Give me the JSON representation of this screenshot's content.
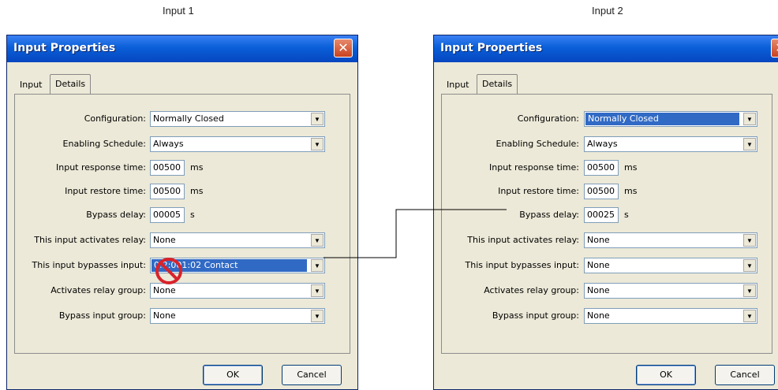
{
  "captions": [
    "Input 1",
    "Input 2"
  ],
  "dialogs": [
    {
      "title": "Input Properties",
      "close_glyph": "✕",
      "tabs": [
        "Input",
        "Details"
      ],
      "active_tab": "Details",
      "configuration": "Normally Closed",
      "enabling_schedule": "Always",
      "input_response_time": "00500",
      "input_restore_time": "00500",
      "bypass_delay": "00005",
      "activates_relay": "None",
      "bypasses_input": "0:2:001:02 Contact",
      "activates_relay_group": "None",
      "bypass_input_group": "None",
      "ok": "OK",
      "cancel": "Cancel"
    },
    {
      "title": "Input Properties",
      "close_glyph": "✕",
      "tabs": [
        "Input",
        "Details"
      ],
      "active_tab": "Details",
      "configuration": "Normally Closed",
      "enabling_schedule": "Always",
      "input_response_time": "00500",
      "input_restore_time": "00500",
      "bypass_delay": "00025",
      "activates_relay": "None",
      "bypasses_input": "None",
      "activates_relay_group": "None",
      "bypass_input_group": "None",
      "ok": "OK",
      "cancel": "Cancel"
    }
  ],
  "labels": {
    "configuration": "Configuration:",
    "enabling_schedule": "Enabling Schedule:",
    "input_response_time": "Input response time:",
    "input_restore_time": "Input restore time:",
    "bypass_delay": "Bypass delay:",
    "activates_relay": "This input activates relay:",
    "bypasses_input": "This input bypasses input:",
    "activates_relay_group": "Activates relay group:",
    "bypass_input_group": "Bypass input group:"
  },
  "units": {
    "ms": "ms",
    "s": "s"
  },
  "colors": {
    "title_bar": "#0a5fd8",
    "selection": "#316ac5",
    "no_symbol": "#d8232a"
  }
}
